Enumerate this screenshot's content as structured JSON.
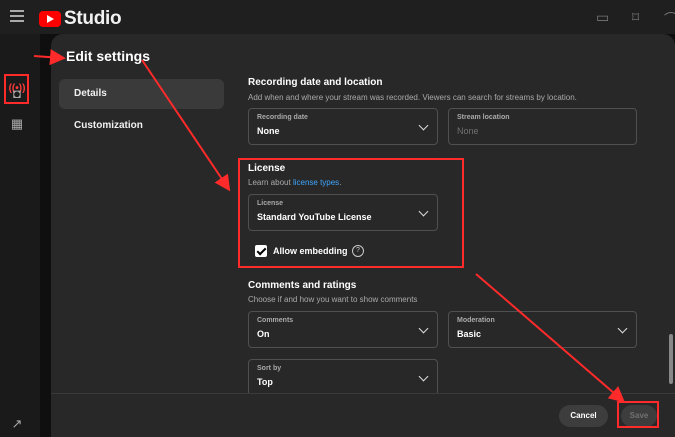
{
  "app": {
    "logo_text": "Studio"
  },
  "dialog": {
    "title": "Edit settings",
    "nav": [
      {
        "label": "Details",
        "active": true
      },
      {
        "label": "Customization",
        "active": false
      }
    ]
  },
  "recording": {
    "title": "Recording date and location",
    "description": "Add when and where your stream was recorded. Viewers can search for streams by location.",
    "date_label": "Recording date",
    "date_value": "None",
    "location_label": "Stream location",
    "location_placeholder": "None"
  },
  "license": {
    "title": "License",
    "learn_prefix": "Learn about ",
    "learn_link": "license types",
    "learn_suffix": ".",
    "field_label": "License",
    "field_value": "Standard YouTube License",
    "embed_label": "Allow embedding",
    "embed_checked": true,
    "help_glyph": "?"
  },
  "comments": {
    "title": "Comments and ratings",
    "description": "Choose if and how you want to show comments",
    "comments_label": "Comments",
    "comments_value": "On",
    "moderation_label": "Moderation",
    "moderation_value": "Basic",
    "sortby_label": "Sort by",
    "sortby_value": "Top"
  },
  "footer": {
    "cancel_label": "Cancel",
    "save_label": "Save"
  },
  "colors": {
    "accent_red": "#ff2a2a",
    "link_blue": "#3ea6ff",
    "yt_red": "#ff0000"
  }
}
